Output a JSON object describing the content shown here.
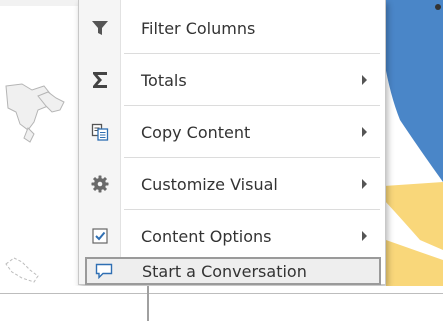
{
  "menu": {
    "items": [
      {
        "label": "Filter Columns",
        "icon": "filter-icon",
        "has_submenu": false
      },
      {
        "label": "Totals",
        "icon": "sigma-icon",
        "has_submenu": true
      },
      {
        "label": "Copy Content",
        "icon": "copy-icon",
        "has_submenu": true
      },
      {
        "label": "Customize Visual",
        "icon": "gear-icon",
        "has_submenu": true
      },
      {
        "label": "Content Options",
        "icon": "checkbox-icon",
        "has_submenu": true
      },
      {
        "label": "Start a Conversation",
        "icon": "speech-bubble-icon",
        "has_submenu": false,
        "highlighted": true
      }
    ]
  },
  "colors": {
    "icon_dark": "#555555",
    "icon_blue": "#2f6fb3",
    "chart_blue": "#4a86c8",
    "chart_yellow": "#f9d77a",
    "map_stroke": "#b5b5b5"
  }
}
